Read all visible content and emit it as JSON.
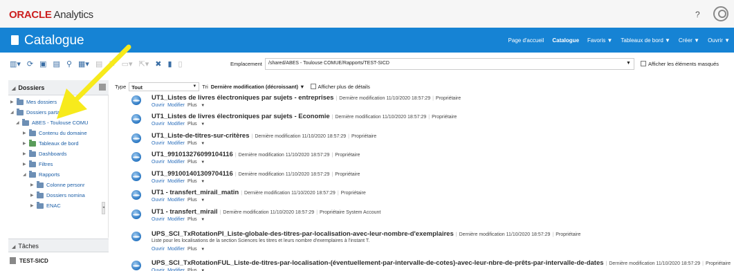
{
  "brand": {
    "oracle": "ORACLE",
    "analytics": "Analytics"
  },
  "top": {
    "help": "?"
  },
  "header": {
    "title": "Catalogue"
  },
  "nav": [
    {
      "label": "Page d'accueil",
      "active": false
    },
    {
      "label": "Catalogue",
      "active": true
    },
    {
      "label": "Favoris ▼",
      "active": false
    },
    {
      "label": "Tableaux de bord ▼",
      "active": false
    },
    {
      "label": "Créer ▼",
      "active": false
    },
    {
      "label": "Ouvrir ▼",
      "active": false
    }
  ],
  "toolbar": {
    "location_label": "Emplacement",
    "location_value": "/shared/ABES - Toulouse COMUE/Rapports/TEST-SICD",
    "hidden_label": "Afficher les éléments masqués"
  },
  "left": {
    "folders_title": "Dossiers",
    "tree": [
      {
        "label": "Mes dossiers",
        "level": 0,
        "expanded": false,
        "green": false
      },
      {
        "label": "Dossiers partagés",
        "level": 0,
        "expanded": true,
        "green": false
      },
      {
        "label": "ABES - Toulouse COMU",
        "level": 1,
        "expanded": true,
        "green": false
      },
      {
        "label": "Contenu du domaine",
        "level": 2,
        "expanded": false,
        "green": false
      },
      {
        "label": "Tableaux de bord",
        "level": 2,
        "expanded": false,
        "green": true
      },
      {
        "label": "Dashboards",
        "level": 2,
        "expanded": false,
        "green": false
      },
      {
        "label": "Filtres",
        "level": 2,
        "expanded": false,
        "green": false
      },
      {
        "label": "Rapports",
        "level": 2,
        "expanded": true,
        "green": false
      },
      {
        "label": "Colonne personr",
        "level": 3,
        "expanded": false,
        "green": false
      },
      {
        "label": "Dossiers nomina",
        "level": 3,
        "expanded": false,
        "green": false
      },
      {
        "label": "ENAC",
        "level": 3,
        "expanded": false,
        "green": false
      }
    ],
    "tasks_title": "Tâches",
    "task_item": "TEST-SICD"
  },
  "filter": {
    "type_label": "Type",
    "type_value": "Tout",
    "sort_label": "Tri",
    "sort_value": "Dernière modification (décroissant) ▼",
    "details_label": "Afficher plus de détails"
  },
  "actions": {
    "open": "Ouvrir",
    "edit": "Modifier",
    "more": "Plus"
  },
  "items": [
    {
      "name": "UT1_Listes de livres électroniques par sujets - entreprises",
      "modified": "Dernière modification 11/10/2020 18:57:29",
      "owner": "Propriétaire",
      "desc": ""
    },
    {
      "name": "UT1_Listes de livres électroniques par sujets - Economie",
      "modified": "Dernière modification 11/10/2020 18:57:29",
      "owner": "Propriétaire",
      "desc": ""
    },
    {
      "name": "UT1_Liste-de-titres-sur-critères",
      "modified": "Dernière modification 11/10/2020 18:57:29",
      "owner": "Propriétaire",
      "desc": ""
    },
    {
      "name": "UT1_991013276099104116",
      "modified": "Dernière modification 11/10/2020 18:57:29",
      "owner": "Propriétaire",
      "desc": ""
    },
    {
      "name": "UT1_991001401309704116",
      "modified": "Dernière modification 11/10/2020 18:57:29",
      "owner": "Propriétaire",
      "desc": ""
    },
    {
      "name": "UT1 - transfert_mirail_matin",
      "modified": "Dernière modification 11/10/2020 18:57:29",
      "owner": "Propriétaire",
      "desc": ""
    },
    {
      "name": "UT1 - transfert_mirail",
      "modified": "Dernière modification 11/10/2020 18:57:29",
      "owner": "Propriétaire System Account",
      "desc": ""
    },
    {
      "name": "UPS_SCI_TxRotationPI_Liste-globale-des-titres-par-localisation-avec-leur-nombre-d'exemplaires",
      "modified": "Dernière modification 11/10/2020 18:57:29",
      "owner": "Propriétaire",
      "desc": "Liste pour les localisations de la section Sciences les titres et leurs nombre d'exemplaires à l'instant T."
    },
    {
      "name": "UPS_SCI_TxRotationFUL_Liste-de-titres-par-localisation-(éventuellement-par-intervalle-de-cotes)-avec-leur-nbre-de-prêts-par-intervalle-de-dates",
      "modified": "Dernière modification 11/10/2020 18:57:29",
      "owner": "Propriétaire",
      "desc": ""
    }
  ]
}
